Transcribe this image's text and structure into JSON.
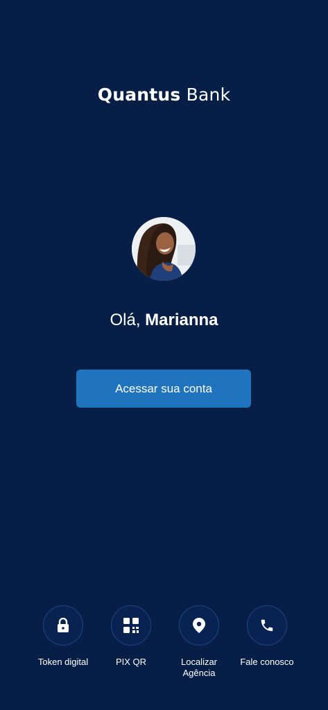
{
  "brand": {
    "name_bold": "Quantus",
    "name_light": "Bank"
  },
  "greeting": {
    "prefix": "Olá,",
    "name": "Marianna"
  },
  "access_button": {
    "label": "Acessar sua conta"
  },
  "quick_actions": [
    {
      "label": "Token digital",
      "icon": "lock-icon"
    },
    {
      "label": "PIX QR",
      "icon": "qr-code-icon"
    },
    {
      "label": "Localizar Agência",
      "icon": "location-pin-icon"
    },
    {
      "label": "Fale conosco",
      "icon": "phone-icon"
    }
  ],
  "colors": {
    "background": "#071f47",
    "button": "#1f74bd",
    "icon_circle_border": "#1d4683",
    "text": "#ffffff"
  }
}
